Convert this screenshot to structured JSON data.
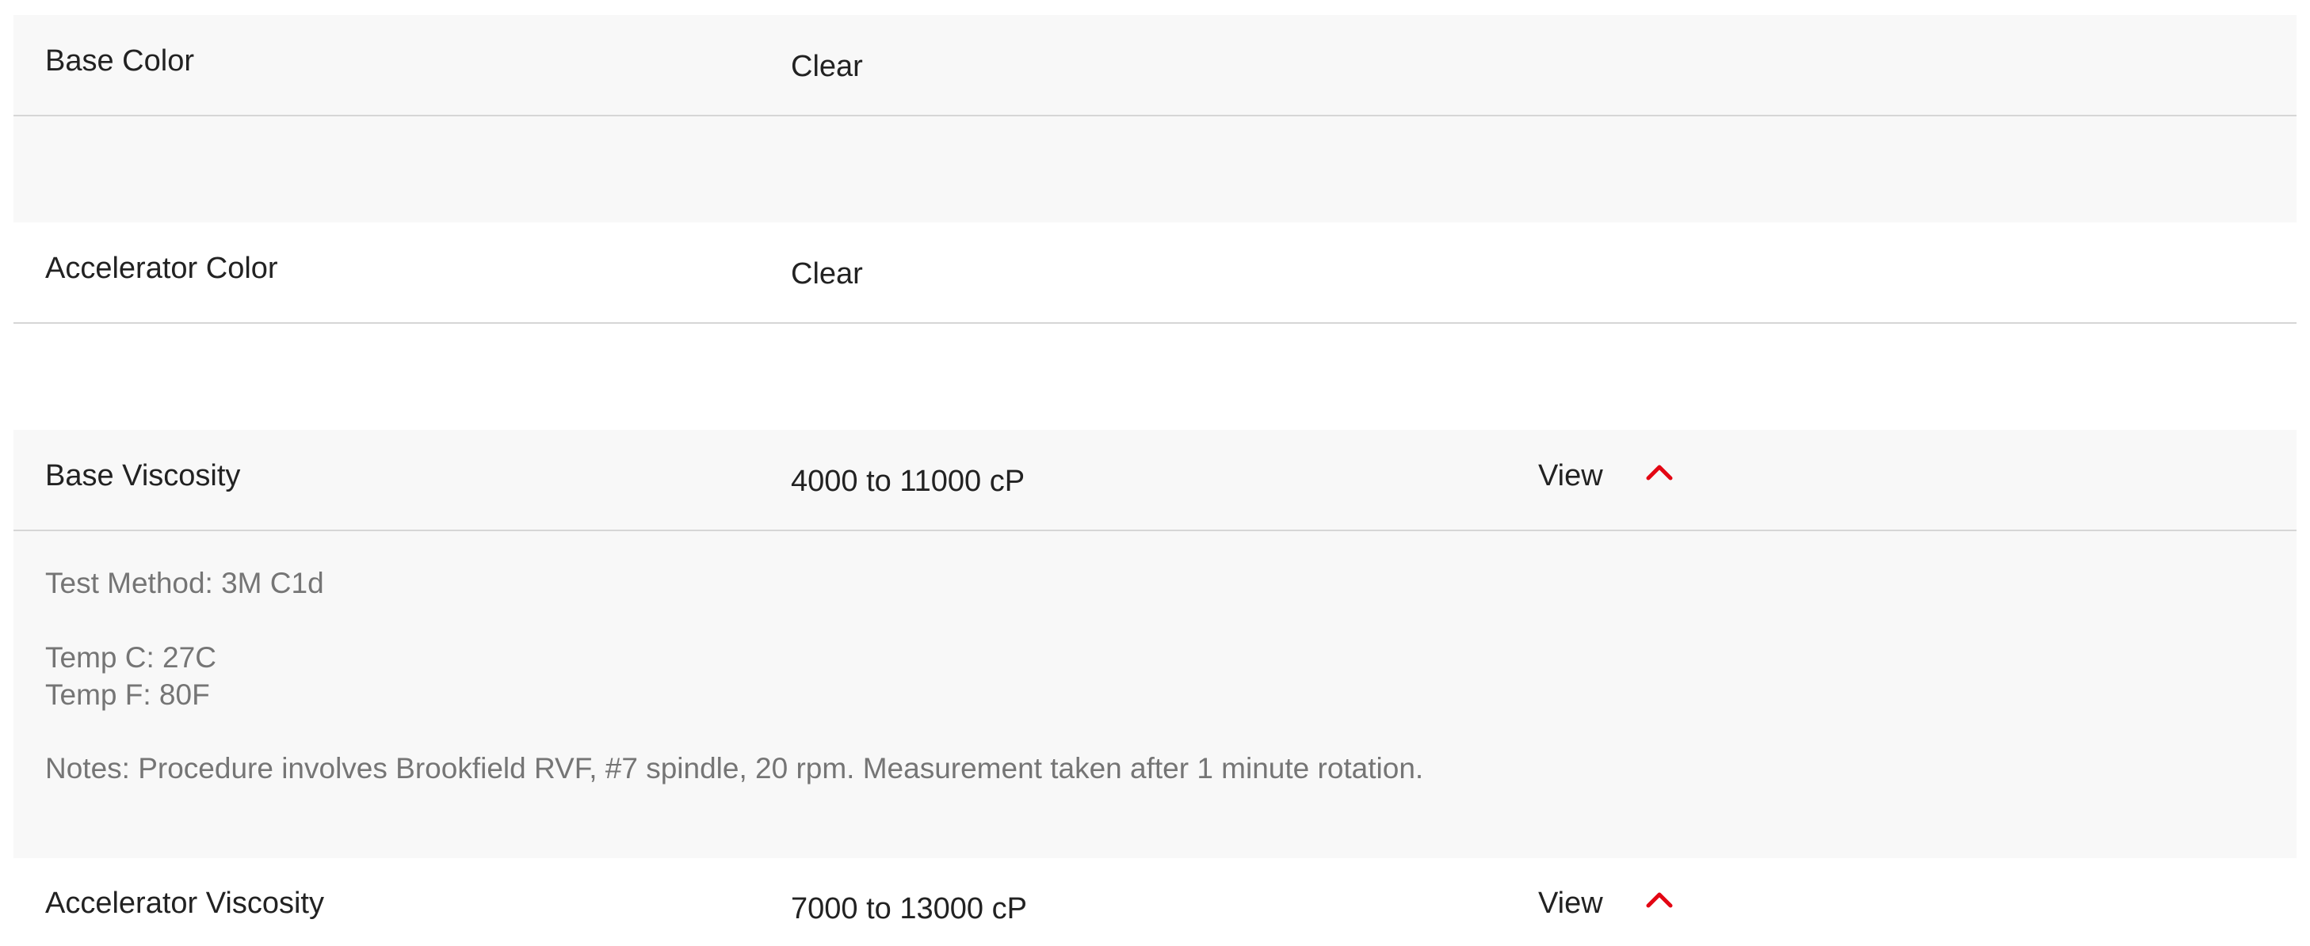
{
  "properties": [
    {
      "label": "Base Color",
      "value": "Clear"
    },
    {
      "label": "Accelerator Color",
      "value": "Clear"
    },
    {
      "label": "Base Viscosity",
      "value": "4000 to 11000 cP",
      "view_label": "View",
      "icon": "chevron-up-icon"
    },
    {
      "label": "Accelerator Viscosity",
      "value": "7000 to 13000 cP",
      "view_label": "View",
      "icon": "chevron-up-icon"
    }
  ],
  "base_viscosity_details": {
    "test_method": "Test Method: 3M C1d",
    "temp_c": "Temp C: 27C",
    "temp_f": "Temp F: 80F",
    "notes": "Notes: Procedure involves Brookfield RVF, #7 spindle, 20 rpm. Measurement taken after 1 minute rotation."
  },
  "colors": {
    "row_background": "#f8f8f8",
    "divider": "#d6d6d6",
    "accent": "#e30613",
    "detail_text": "#757575"
  }
}
